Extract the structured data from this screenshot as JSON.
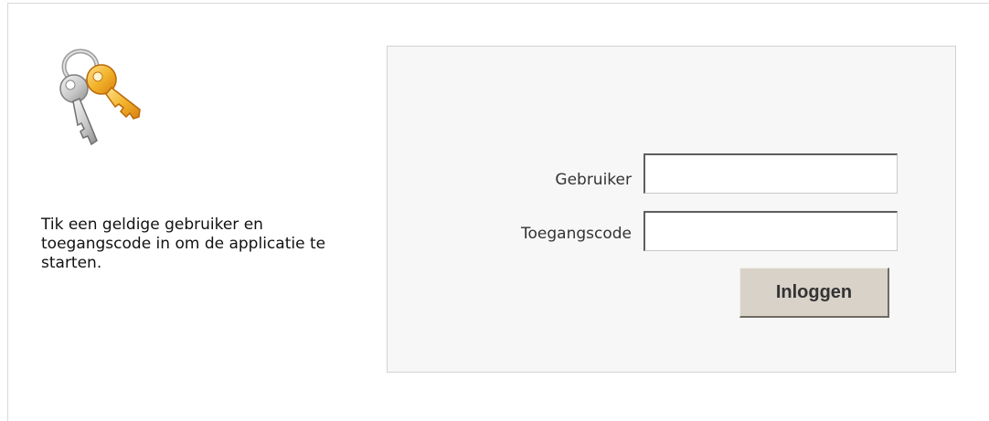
{
  "intro": {
    "icon": "keys-icon",
    "message": "Tik een geldige gebruiker en toegangscode in om de applicatie te starten."
  },
  "login": {
    "user_label": "Gebruiker",
    "user_value": "",
    "code_label": "Toegangscode",
    "code_value": "",
    "submit_label": "Inloggen"
  },
  "colors": {
    "panel_background": "#f7f7f7",
    "button_background": "#d8d2c9",
    "key_gold": "#f2b42c",
    "key_silver": "#c9c9c9"
  }
}
